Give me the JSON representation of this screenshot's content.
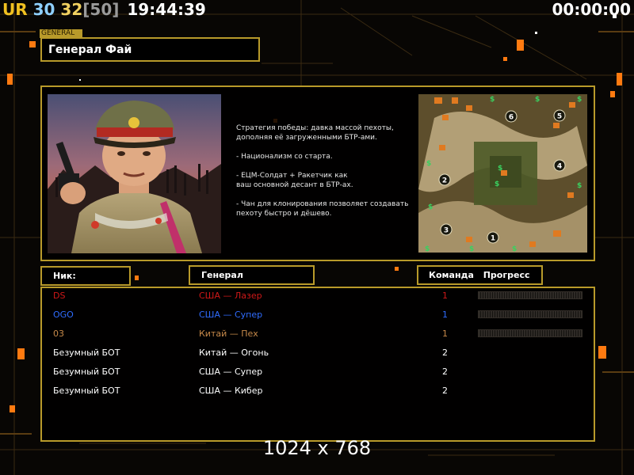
{
  "hud": {
    "ur_label": "UR",
    "fps_value": "30",
    "fps_value2": "32",
    "fps_limit": "[50]",
    "clock": "19:44:39",
    "timer": "00:00:00",
    "colors": {
      "ur": "#f0c020",
      "fps1": "#8fd0ff",
      "fps2": "#f0d060",
      "limit": "#9a9a9a"
    }
  },
  "general": {
    "tag": "GENERAL",
    "name": "Генерал Фай",
    "description": "Стратегия победы: давка массой пехоты,\n дополняя её загруженными БТР-ами.\n\n- Национализм со старта.\n\n- ЕЦМ-Солдат + Ракетчик как\nваш основной десант в БТР-ах.\n\n- Чан для клонирования позволяет создавать\n пехоту быстро и дёшево."
  },
  "minimap": {
    "start_positions": [
      "1",
      "2",
      "3",
      "4",
      "5",
      "6"
    ],
    "supply_symbol": "$"
  },
  "table": {
    "headers": {
      "nick": "Ник:",
      "general": "Генерал",
      "team": "Команда",
      "progress": "Прогресс"
    },
    "rows": [
      {
        "nick": "DS",
        "general": "США — Лазер",
        "team": "1",
        "color": "#d01818",
        "progress": 0.0,
        "show_progress": true
      },
      {
        "nick": "OGO",
        "general": "США — Супер",
        "team": "1",
        "color": "#2f6cff",
        "progress": 0.0,
        "show_progress": true
      },
      {
        "nick": "03",
        "general": "Китай — Пех",
        "team": "1",
        "color": "#c88a4a",
        "progress": 0.0,
        "show_progress": true
      },
      {
        "nick": "Безумный БОТ",
        "general": "Китай — Огонь",
        "team": "2",
        "color": "#ffffff",
        "progress": null,
        "show_progress": false
      },
      {
        "nick": "Безумный БОТ",
        "general": "США — Супер",
        "team": "2",
        "color": "#ffffff",
        "progress": null,
        "show_progress": false
      },
      {
        "nick": "Безумный БОТ",
        "general": "США — Кибер",
        "team": "2",
        "color": "#ffffff",
        "progress": null,
        "show_progress": false
      }
    ]
  },
  "resolution": "1024 x 768",
  "accent": "#b89a2a"
}
